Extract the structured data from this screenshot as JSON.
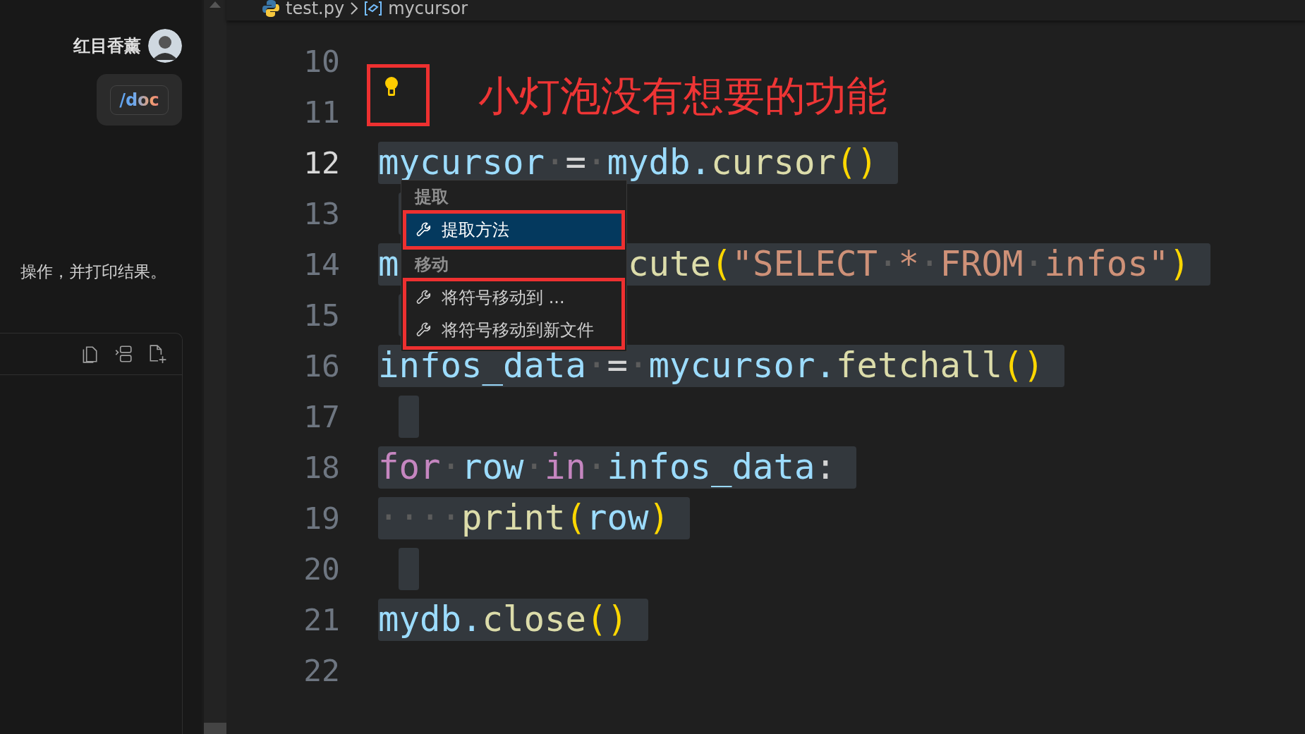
{
  "chat_panel": {
    "user": {
      "name": "红目香薰"
    },
    "command_chip": {
      "text": "/doc"
    },
    "message": "操作，并打印结果。"
  },
  "breadcrumb": {
    "file": "test.py",
    "symbol": "mycursor"
  },
  "annotation": {
    "text": "小灯泡没有想要的功能"
  },
  "editor": {
    "lines": [
      {
        "number": "10",
        "current": false,
        "selected": false
      },
      {
        "number": "11",
        "current": false,
        "selected": false
      },
      {
        "number": "12",
        "current": true,
        "selected": true,
        "tokens": [
          {
            "kind": "var",
            "text": "mycursor"
          },
          {
            "kind": "ws",
            "text": "·"
          },
          {
            "kind": "op",
            "text": "="
          },
          {
            "kind": "ws",
            "text": "·"
          },
          {
            "kind": "var",
            "text": "mydb."
          },
          {
            "kind": "func",
            "text": "cursor"
          },
          {
            "kind": "paren",
            "text": "()"
          }
        ]
      },
      {
        "number": "13",
        "current": false,
        "selected": true
      },
      {
        "number": "14",
        "current": false,
        "selected": true,
        "tokens": [
          {
            "kind": "var",
            "text": "m"
          },
          {
            "kind": "covered"
          },
          {
            "kind": "func",
            "text": "cute"
          },
          {
            "kind": "paren",
            "text": "("
          },
          {
            "kind": "str",
            "text": "\"SELECT"
          },
          {
            "kind": "ws",
            "text": "·"
          },
          {
            "kind": "str",
            "text": "*"
          },
          {
            "kind": "ws",
            "text": "·"
          },
          {
            "kind": "str",
            "text": "FROM"
          },
          {
            "kind": "ws",
            "text": "·"
          },
          {
            "kind": "str",
            "text": "infos\""
          },
          {
            "kind": "paren",
            "text": ")"
          }
        ]
      },
      {
        "number": "15",
        "current": false,
        "selected": true
      },
      {
        "number": "16",
        "current": false,
        "selected": true,
        "tokens": [
          {
            "kind": "var",
            "text": "infos_data"
          },
          {
            "kind": "ws",
            "text": "·"
          },
          {
            "kind": "op",
            "text": "="
          },
          {
            "kind": "ws",
            "text": "·"
          },
          {
            "kind": "var",
            "text": "mycursor."
          },
          {
            "kind": "func",
            "text": "fetchall"
          },
          {
            "kind": "paren",
            "text": "()"
          }
        ]
      },
      {
        "number": "17",
        "current": false,
        "selected": true
      },
      {
        "number": "18",
        "current": false,
        "selected": true,
        "tokens": [
          {
            "kind": "kw",
            "text": "for"
          },
          {
            "kind": "ws",
            "text": "·"
          },
          {
            "kind": "var",
            "text": "row"
          },
          {
            "kind": "ws",
            "text": "·"
          },
          {
            "kind": "kw",
            "text": "in"
          },
          {
            "kind": "ws",
            "text": "·"
          },
          {
            "kind": "var",
            "text": "infos_data"
          },
          {
            "kind": "op",
            "text": ":"
          }
        ]
      },
      {
        "number": "19",
        "current": false,
        "selected": true,
        "tokens": [
          {
            "kind": "ws",
            "text": "····"
          },
          {
            "kind": "func",
            "text": "print"
          },
          {
            "kind": "paren",
            "text": "("
          },
          {
            "kind": "var",
            "text": "row"
          },
          {
            "kind": "paren",
            "text": ")"
          }
        ]
      },
      {
        "number": "20",
        "current": false,
        "selected": true
      },
      {
        "number": "21",
        "current": false,
        "selected": true,
        "tokens": [
          {
            "kind": "var",
            "text": "mydb."
          },
          {
            "kind": "func",
            "text": "close"
          },
          {
            "kind": "paren",
            "text": "()"
          }
        ]
      },
      {
        "number": "22",
        "current": false,
        "selected": false
      }
    ]
  },
  "code_actions": {
    "groups": [
      {
        "header": "提取",
        "framed": true,
        "items": [
          {
            "label": "提取方法",
            "selected": true
          }
        ]
      },
      {
        "header": "移动",
        "framed": true,
        "items": [
          {
            "label": "将符号移动到 ...",
            "selected": false
          },
          {
            "label": "将符号移动到新文件",
            "selected": false
          }
        ]
      }
    ]
  }
}
